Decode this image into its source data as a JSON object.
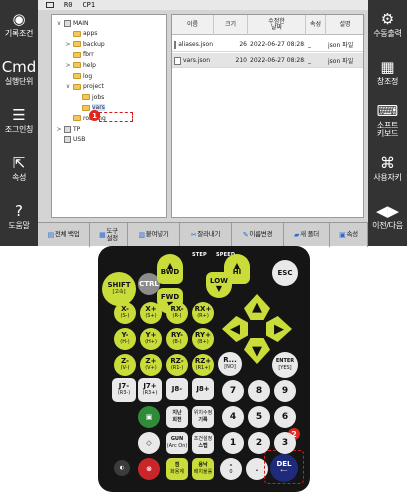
{
  "status_bar": {
    "mode": "R0",
    "cycle": "CP1"
  },
  "left_sidebar": [
    {
      "icon": "record-icon",
      "glyph": "◉",
      "label": "기록조건"
    },
    {
      "icon": "cmd-icon",
      "glyph": "Cmd",
      "label": "실행단위"
    },
    {
      "icon": "sliders-icon",
      "glyph": "☰",
      "label": "조그인칭"
    },
    {
      "icon": "external-link-icon",
      "glyph": "⇱",
      "label": "속성"
    },
    {
      "icon": "help-icon",
      "glyph": "?",
      "label": "도움말"
    }
  ],
  "right_sidebar": [
    {
      "icon": "gear-icon",
      "glyph": "⚙",
      "label": "수동출력"
    },
    {
      "icon": "grid-icon",
      "glyph": "▦",
      "label": "창조정"
    },
    {
      "icon": "keyboard-icon",
      "glyph": "⌨",
      "label": "소프트\n키보드"
    },
    {
      "icon": "user-key-icon",
      "glyph": "⌘",
      "label": "사용자키"
    },
    {
      "icon": "prev-next-icon",
      "glyph": "◀▶",
      "label": "이전/다음"
    }
  ],
  "tree": {
    "nodes": [
      {
        "label": "MAIN",
        "type": "drive",
        "level": 0,
        "expander": "∨"
      },
      {
        "label": "apps",
        "type": "folder",
        "level": 1,
        "expander": ""
      },
      {
        "label": "backup",
        "type": "folder",
        "level": 1,
        "expander": ">"
      },
      {
        "label": "fbrr",
        "type": "folder",
        "level": 1,
        "expander": ""
      },
      {
        "label": "help",
        "type": "folder",
        "level": 1,
        "expander": ">"
      },
      {
        "label": "log",
        "type": "folder",
        "level": 1,
        "expander": ""
      },
      {
        "label": "project",
        "type": "folder",
        "level": 1,
        "expander": "∨"
      },
      {
        "label": "jobs",
        "type": "folder",
        "level": 2,
        "expander": ""
      },
      {
        "label": "vars",
        "type": "folder",
        "level": 2,
        "expander": "",
        "selected": true
      },
      {
        "label": "roblang",
        "type": "folder",
        "level": 1,
        "expander": ""
      },
      {
        "label": "TP",
        "type": "drive",
        "level": 0,
        "expander": ">"
      },
      {
        "label": "USB",
        "type": "drive",
        "level": 0,
        "expander": ""
      }
    ],
    "marker": "1"
  },
  "file_table": {
    "columns": [
      "이름",
      "크기",
      "수정한\n날짜",
      "속성",
      "설명"
    ],
    "rows": [
      {
        "name": "aliases.json",
        "size": "26",
        "date": "2022-06-27 08:28:47",
        "attr": "_",
        "desc": "json 파일"
      },
      {
        "name": "vars.json",
        "size": "210",
        "date": "2022-06-27 08:28:47",
        "attr": "_",
        "desc": "json 파일",
        "selected": true
      }
    ]
  },
  "toolbar": [
    {
      "icon": "backup-icon",
      "label": "전체 백업"
    },
    {
      "icon": "tool-icon",
      "label": "도구\n설정"
    },
    {
      "icon": "paste-icon",
      "label": "붙여넣기"
    },
    {
      "icon": "cut-icon",
      "label": "잘라내기"
    },
    {
      "icon": "rename-icon",
      "label": "이름변경"
    },
    {
      "icon": "new-folder-icon",
      "label": "새 폴더"
    },
    {
      "icon": "properties-icon",
      "label": "속성"
    }
  ],
  "keypad": {
    "step_label": "STEP",
    "speed_label": "SPEED",
    "shift": {
      "main": "SHIFT",
      "sub": "[고속]"
    },
    "ctrl": "CTRL",
    "bwd": "BWD",
    "fwd": "FWD",
    "low": "LOW",
    "hi": "HI",
    "esc": "ESC",
    "axes": [
      {
        "main": "X-",
        "sub": "(S-)"
      },
      {
        "main": "X+",
        "sub": "(S+)"
      },
      {
        "main": "RX-",
        "sub": "(R-)"
      },
      {
        "main": "RX+",
        "sub": "(R+)"
      },
      {
        "main": "Y-",
        "sub": "(H-)"
      },
      {
        "main": "Y+",
        "sub": "(H+)"
      },
      {
        "main": "RY-",
        "sub": "(B-)"
      },
      {
        "main": "RY+",
        "sub": "(B+)"
      },
      {
        "main": "Z-",
        "sub": "(V-)"
      },
      {
        "main": "Z+",
        "sub": "(V+)"
      },
      {
        "main": "RZ-",
        "sub": "(R1-)"
      },
      {
        "main": "RZ+",
        "sub": "(R1+)"
      }
    ],
    "j7_minus": {
      "main": "J7-",
      "sub": "(R3-)"
    },
    "j7_plus": {
      "main": "J7+",
      "sub": "(R3+)"
    },
    "j8_minus": "J8-",
    "j8_plus": "J8+",
    "r_no": {
      "main": "R...",
      "sub": "[NO]"
    },
    "enter": {
      "main": "ENTER",
      "sub": "[YES]"
    },
    "digits": [
      "7",
      "8",
      "9",
      "4",
      "5",
      "6",
      "1",
      "2",
      "3",
      "0"
    ],
    "minus": "-",
    "dot": ".",
    "del": "DEL",
    "prev_step": {
      "main": "지난\n회전",
      "sub": ""
    },
    "mode_record": {
      "main": "위치수정",
      "sub": "기록"
    },
    "cond_set": {
      "main": "조건설정",
      "sub": "스텝"
    },
    "gun": {
      "main": "GUN",
      "sub": "(Arc On)"
    },
    "point": {
      "main": "점",
      "sub": "화용계"
    },
    "wrist": {
      "main": "용낙",
      "sub": "배치율률"
    },
    "marker": "2"
  }
}
